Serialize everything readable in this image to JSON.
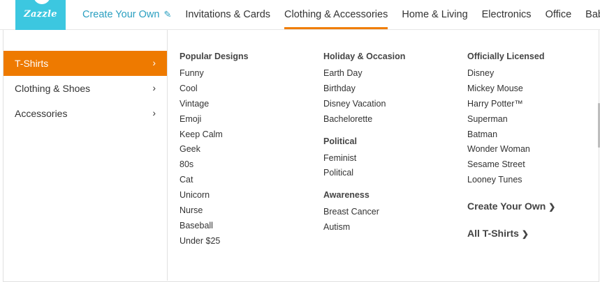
{
  "logo": {
    "text": "Zazzle"
  },
  "nav": {
    "create": "Create Your Own",
    "items": [
      "Invitations & Cards",
      "Clothing & Accessories",
      "Home & Living",
      "Electronics",
      "Office",
      "Baby &"
    ]
  },
  "categories": [
    "T-Shirts",
    "Clothing & Shoes",
    "Accessories"
  ],
  "columns": {
    "popular": {
      "heading": "Popular Designs",
      "links": [
        "Funny",
        "Cool",
        "Vintage",
        "Emoji",
        "Keep Calm",
        "Geek",
        "80s",
        "Cat",
        "Unicorn",
        "Nurse",
        "Baseball",
        "Under $25"
      ]
    },
    "holiday": {
      "heading": "Holiday & Occasion",
      "links": [
        "Earth Day",
        "Birthday",
        "Disney Vacation",
        "Bachelorette"
      ]
    },
    "political": {
      "heading": "Political",
      "links": [
        "Feminist",
        "Political"
      ]
    },
    "awareness": {
      "heading": "Awareness",
      "links": [
        "Breast Cancer",
        "Autism"
      ]
    },
    "licensed": {
      "heading": "Officially Licensed",
      "links": [
        "Disney",
        "Mickey Mouse",
        "Harry Potter™",
        "Superman",
        "Batman",
        "Wonder Woman",
        "Sesame Street",
        "Looney Tunes"
      ]
    },
    "create_your_own": "Create Your Own",
    "all_tshirts": "All T-Shirts"
  },
  "colors": {
    "accent": "#ee7a00",
    "logo_bg": "#3cc7e0",
    "link_blue": "#2a9fc0"
  }
}
